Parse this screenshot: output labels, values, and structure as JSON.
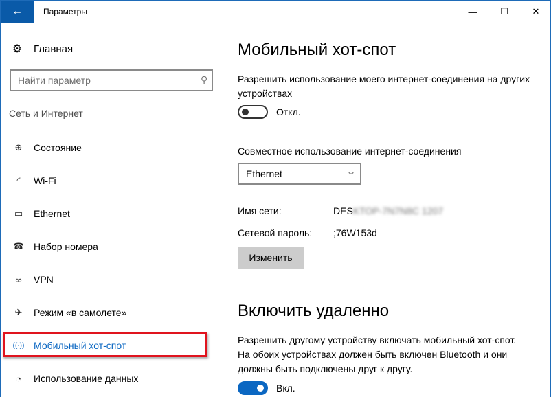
{
  "window": {
    "title": "Параметры",
    "controls": {
      "minimize": "—",
      "maximize": "☐",
      "close": "✕"
    }
  },
  "sidebar": {
    "home_label": "Главная",
    "search_placeholder": "Найти параметр",
    "section_label": "Сеть и Интернет",
    "items": [
      {
        "label": "Состояние",
        "icon": "globe-network-icon",
        "glyph": "⊕"
      },
      {
        "label": "Wi-Fi",
        "icon": "wifi-icon",
        "glyph": "◜"
      },
      {
        "label": "Ethernet",
        "icon": "ethernet-icon",
        "glyph": "▭"
      },
      {
        "label": "Набор номера",
        "icon": "dialup-phone-icon",
        "glyph": "☎"
      },
      {
        "label": "VPN",
        "icon": "vpn-icon",
        "glyph": "∞"
      },
      {
        "label": "Режим «в самолете»",
        "icon": "airplane-icon",
        "glyph": "✈"
      },
      {
        "label": "Мобильный хот-спот",
        "icon": "hotspot-icon",
        "glyph": "((·))",
        "active": true
      },
      {
        "label": "Использование данных",
        "icon": "data-usage-icon",
        "glyph": "◔"
      }
    ]
  },
  "main": {
    "title": "Мобильный хот-спот",
    "share_desc": "Разрешить использование моего интернет-соединения на других устройствах",
    "share_toggle": {
      "state": "off",
      "label": "Откл."
    },
    "share_from_label": "Совместное использование интернет-соединения",
    "share_from_value": "Ethernet",
    "network_name_label": "Имя сети:",
    "network_name_value_visible": "DES",
    "network_name_value_blurred": "KTOP-7N7N8C 1207",
    "password_label": "Сетевой пароль:",
    "password_value": ";76W153d",
    "edit_button": "Изменить",
    "remote_title": "Включить удаленно",
    "remote_desc": "Разрешить другому устройству включать мобильный хот-спот. На обоих устройствах должен быть включен Bluetooth и они должны быть подключены друг к другу.",
    "remote_toggle": {
      "state": "on",
      "label": "Вкл."
    }
  },
  "colors": {
    "accent": "#0b67c2",
    "titlebar_back": "#0a5aa8",
    "highlight_box": "#e0141e"
  }
}
